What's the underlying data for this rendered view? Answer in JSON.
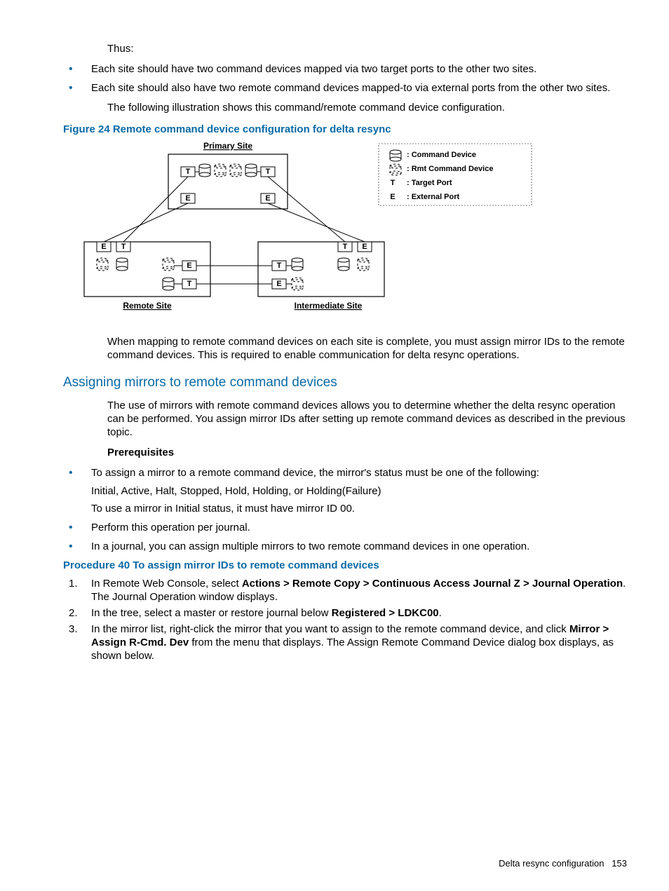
{
  "intro_para": "Thus:",
  "bullets_top": [
    "Each site should have two command devices mapped via two target ports to the other two sites.",
    "Each site should also have two remote command devices mapped-to via external ports from the other two sites."
  ],
  "following_text": "The following illustration shows this command/remote command device configuration.",
  "figure_caption": "Figure 24 Remote command device configuration for delta resync",
  "diagram": {
    "primary": "Primary Site",
    "remote": "Remote Site",
    "intermediate": "Intermediate Site",
    "T": "T",
    "E": "E",
    "legend_cmd": ": Command Device",
    "legend_rmt": ": Rmt Command Device",
    "legend_t": ": Target Port",
    "legend_e": ": External Port"
  },
  "after_figure": "When mapping to remote command devices on each site is complete, you must assign mirror IDs to the remote command devices. This is required to enable communication for delta resync operations.",
  "section_heading": "Assigning mirrors to remote command devices",
  "section_para": "The use of mirrors with remote command devices allows you to determine whether the delta resync operation can be performed. You assign mirror IDs after setting up remote command devices as described in the previous topic.",
  "prereq_heading": "Prerequisites",
  "prereq_bullets": [
    {
      "line1": "To assign a mirror to a remote command device, the mirror's status must be one of the following:",
      "line2": "Initial, Active, Halt, Stopped, Hold, Holding, or Holding(Failure)",
      "line3": "To use a mirror in Initial status, it must have mirror ID 00."
    },
    {
      "line1": "Perform this operation per journal."
    },
    {
      "line1": "In a journal, you can assign multiple mirrors to two remote command devices in one operation."
    }
  ],
  "procedure_caption": "Procedure 40 To assign mirror IDs to remote command devices",
  "steps": {
    "s1_a": "In Remote Web Console, select ",
    "s1_b": "Actions > Remote Copy > Continuous Access Journal Z > Journal Operation",
    "s1_c": ". The Journal Operation window displays.",
    "s2_a": "In the tree, select a master or restore journal below ",
    "s2_b": "Registered > LDKC00",
    "s2_c": ".",
    "s3_a": "In the mirror list, right-click the mirror that you want to assign to the remote command device, and click ",
    "s3_b": "Mirror > Assign R-Cmd. Dev",
    "s3_c": " from the menu that displays. The Assign Remote Command Device dialog box displays, as shown below."
  },
  "footer_text": "Delta resync configuration",
  "footer_page": "153"
}
